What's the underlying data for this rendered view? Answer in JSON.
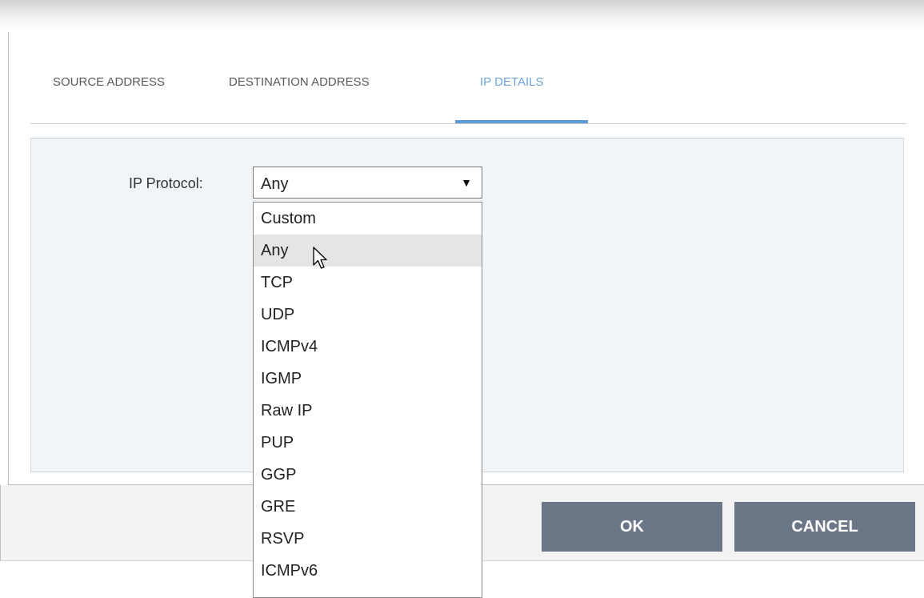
{
  "tabs": [
    {
      "label": "SOURCE ADDRESS"
    },
    {
      "label": "DESTINATION ADDRESS"
    },
    {
      "label": "IP DETAILS"
    }
  ],
  "active_tab": "IP DETAILS",
  "form": {
    "ip_protocol_label": "IP Protocol:",
    "ip_protocol_value": "Any"
  },
  "dropdown": {
    "options": [
      "Custom",
      "Any",
      "TCP",
      "UDP",
      "ICMPv4",
      "IGMP",
      "Raw IP",
      "PUP",
      "GGP",
      "GRE",
      "RSVP",
      "ICMPv6"
    ],
    "hovered": "Any"
  },
  "buttons": {
    "ok": "OK",
    "cancel": "CANCEL"
  },
  "colors": {
    "accent": "#5b9bd5",
    "button_bg": "#6b7686",
    "panel_bg": "#f1f5f8"
  },
  "icons": {
    "dropdown_arrow": "caret-down-icon",
    "cursor": "mouse-pointer-icon"
  }
}
